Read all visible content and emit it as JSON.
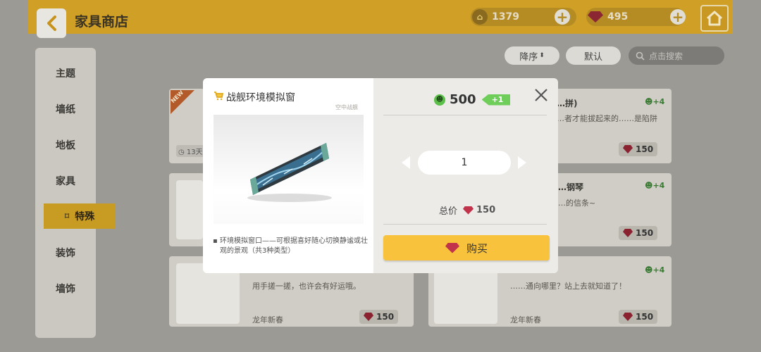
{
  "header": {
    "title": "家具商店",
    "coins": "1379",
    "gems": "495"
  },
  "toolbar": {
    "sort_label": "降序",
    "default_label": "默认",
    "search_placeholder": "点击搜索"
  },
  "sidebar": {
    "items": [
      {
        "label": "主题"
      },
      {
        "label": "墙纸"
      },
      {
        "label": "地板"
      },
      {
        "label": "家具"
      },
      {
        "label": "特殊"
      },
      {
        "label": "装饰"
      },
      {
        "label": "墙饰"
      }
    ],
    "active_index": 4
  },
  "cards": [
    {
      "badge": "NEW",
      "timer": "13天",
      "title": "…拼)",
      "desc": "…者才能拔起来的……是陷阱",
      "happy": "+4",
      "price": "150"
    },
    {
      "title": "…钢琴",
      "desc": "…的信条~",
      "happy": "+4",
      "price": "150"
    },
    {
      "desc": "用手搓一搓，也许会有好运哦。",
      "tag": "龙年新春",
      "price": "150"
    },
    {
      "desc": "……通向哪里？站上去就知道了！",
      "tag": "龙年新春",
      "happy": "+4",
      "price": "150"
    }
  ],
  "modal": {
    "item_name": "战舰环境模拟窗",
    "category": "空中战舰",
    "description": "环境模拟窗口——可根据喜好随心切换静谧或壮观的景观（共3种类型）",
    "comfort": "500",
    "comfort_bonus": "+1",
    "quantity": "1",
    "total_label": "总价",
    "total_price": "150",
    "buy_label": "购买"
  },
  "colors": {
    "topbar": "#cf9f26",
    "buy_button": "#f9c23c",
    "gem": "#c0334b",
    "happy_green": "#5cbf4a"
  }
}
